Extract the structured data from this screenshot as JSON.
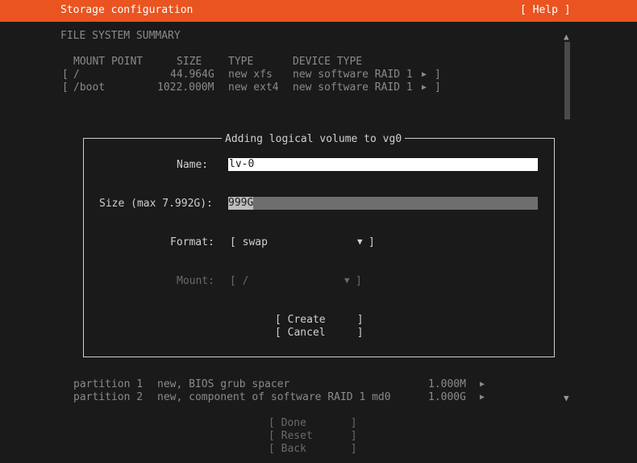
{
  "header": {
    "title": "Storage configuration",
    "help": "[ Help ]"
  },
  "summary": {
    "heading": "FILE SYSTEM SUMMARY",
    "columns": [
      "MOUNT POINT",
      "SIZE",
      "TYPE",
      "DEVICE TYPE"
    ],
    "rows": [
      {
        "bracket": "[",
        "mount": "/",
        "size": "44.964G",
        "type": "new xfs",
        "device": "new software RAID 1",
        "arrow": "▶",
        "end": "]"
      },
      {
        "bracket": "[",
        "mount": "/boot",
        "size": "1022.000M",
        "type": "new ext4",
        "device": "new software RAID 1",
        "arrow": "▶",
        "end": "]"
      }
    ]
  },
  "dialog": {
    "title": "Adding logical volume to vg0",
    "name_label": "Name:",
    "name_value": "lv-0",
    "size_label": "Size (max 7.992G):",
    "size_value": "999G",
    "format_label": "Format:",
    "format_value": "[ swap",
    "format_arrow": "▼",
    "format_end": "]",
    "mount_label": "Mount:",
    "mount_value": "[ /",
    "mount_arrow": "▼",
    "mount_end": "]",
    "create_label": "[ Create     ]",
    "cancel_label": "[ Cancel     ]"
  },
  "partitions": [
    {
      "name": "partition 1",
      "desc": "new, BIOS grub spacer",
      "size": "1.000M",
      "arrow": "▶"
    },
    {
      "name": "partition 2",
      "desc": "new, component of software RAID 1 md0",
      "size": "1.000G",
      "arrow": "▶"
    }
  ],
  "footer": {
    "done": "[ Done       ]",
    "reset": "[ Reset      ]",
    "back": "[ Back       ]"
  },
  "scroll": {
    "up": "▲",
    "down": "▼"
  }
}
